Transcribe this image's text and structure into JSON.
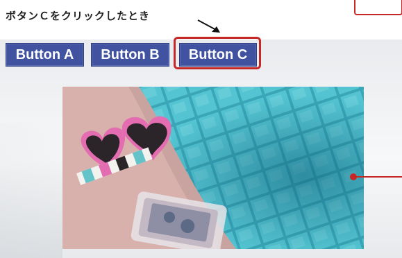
{
  "caption": "ボタンＣをクリックしたとき",
  "tabs": [
    {
      "label": "Button A"
    },
    {
      "label": "Button B"
    },
    {
      "label": "Button C"
    }
  ],
  "colors": {
    "tab_background": "#4052a0",
    "highlight": "#c62828"
  },
  "photo": {
    "icon": "pool-sunglasses-phone-photo"
  }
}
